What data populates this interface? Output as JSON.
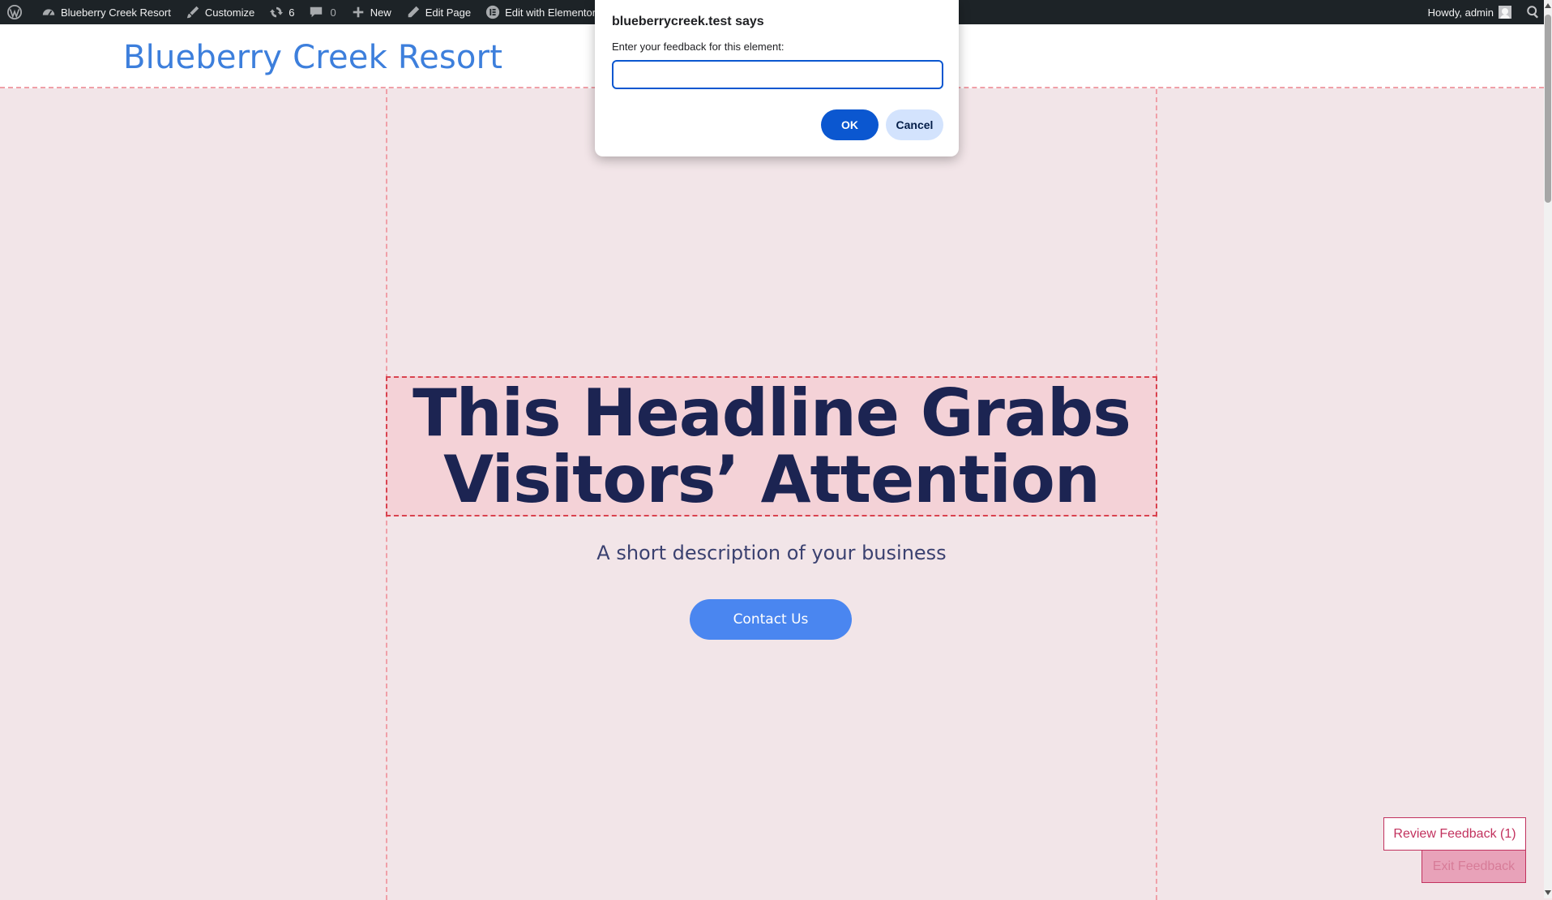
{
  "admin_bar": {
    "site_name": "Blueberry Creek Resort",
    "customize": "Customize",
    "updates_count": "6",
    "comments_count": "0",
    "new": "New",
    "edit_page": "Edit Page",
    "edit_elementor": "Edit with Elementor",
    "howdy": "Howdy, admin"
  },
  "site": {
    "title": "Blueberry Creek Resort"
  },
  "hero": {
    "headline_line1": "This Headline Grabs",
    "headline_line2": "Visitors’ Attention",
    "description": "A short description of your business",
    "cta_label": "Contact Us"
  },
  "dialog": {
    "title": "blueberrycreek.test says",
    "message": "Enter your feedback for this element:",
    "input_value": "",
    "ok_label": "OK",
    "cancel_label": "Cancel"
  },
  "feedback": {
    "review_label": "Review Feedback (1)",
    "exit_label": "Exit Feedback"
  },
  "colors": {
    "site_title": "#3d7fdc",
    "headline": "#1c2452",
    "cta_bg": "#4a86f0",
    "dialog_primary": "#0b57d0",
    "feedback_accent": "#c2325e",
    "page_bg": "#f2e5e8"
  }
}
